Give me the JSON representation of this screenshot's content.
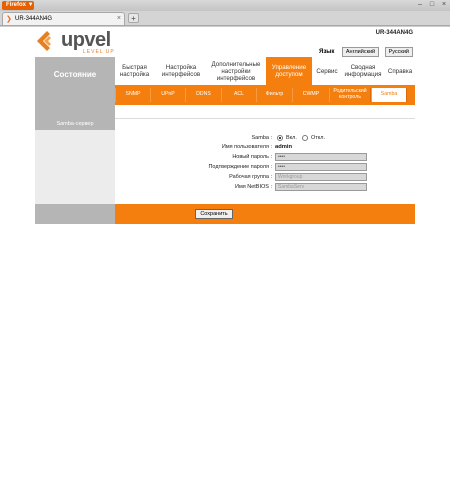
{
  "browser": {
    "menu_button": "Firefox ▼",
    "tab_title": "UR-344AN4G",
    "tab_close": "×",
    "new_tab": "+",
    "win_min": "–",
    "win_max": "□",
    "win_close": "×"
  },
  "header": {
    "model": "UR-344AN4G",
    "logo_text": "upvel",
    "logo_tagline": "LEVEL UP",
    "language_label": "Язык",
    "lang_english": "Английский",
    "lang_russian": "Русский"
  },
  "nav": {
    "status": "Состояние",
    "items": [
      {
        "label": "Быстрая настройка"
      },
      {
        "label": "Настройка интерфейсов"
      },
      {
        "label": "Дополнительные настройки интерфейсов"
      },
      {
        "label": "Управление доступом"
      },
      {
        "label": "Сервис"
      },
      {
        "label": "Сводная информация"
      },
      {
        "label": "Справка"
      }
    ]
  },
  "subnav": {
    "items": [
      {
        "label": "SNMP"
      },
      {
        "label": "UPnP"
      },
      {
        "label": "DDNS"
      },
      {
        "label": "ACL"
      },
      {
        "label": "Фильтр"
      },
      {
        "label": "CWMP"
      },
      {
        "label": "Родительский контроль"
      },
      {
        "label": "Samba"
      }
    ]
  },
  "section": {
    "title": "Samba-сервер"
  },
  "form": {
    "samba_label": "Samba :",
    "samba_on": "Вкл.",
    "samba_off": "Откл.",
    "samba_selected": "on",
    "username_label": "Имя пользователя :",
    "username_value": "admin",
    "new_password_label": "Новый пароль :",
    "new_password_value": "••••",
    "confirm_password_label": "Подтверждение пароля :",
    "confirm_password_value": "••••",
    "workgroup_label": "Рабочая группа :",
    "workgroup_value": "Workgroup",
    "netbios_label": "Имя NetBIOS :",
    "netbios_value": "SambaServ"
  },
  "footer": {
    "save_label": "Сохранить"
  },
  "colors": {
    "accent": "#f47f0f",
    "sidebar_gray": "#b5b5b5"
  }
}
